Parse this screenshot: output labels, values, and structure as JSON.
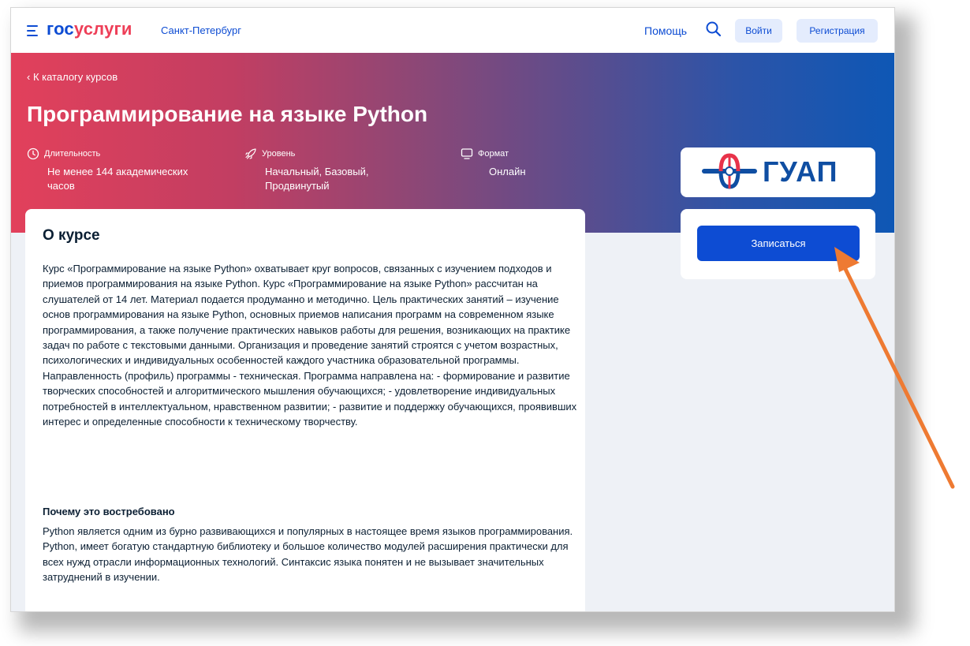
{
  "header": {
    "logo_part1": "гос",
    "logo_part2": "услуги",
    "city": "Санкт-Петербург",
    "help": "Помощь",
    "login": "Войти",
    "register": "Регистрация"
  },
  "hero": {
    "back_link": "‹ К каталогу курсов",
    "title": "Программирование на языке Python",
    "meta": [
      {
        "label": "Длительность",
        "value": "Не менее 144 академических часов"
      },
      {
        "label": "Уровень",
        "value": "Начальный, Базовый, Продвинутый"
      },
      {
        "label": "Формат",
        "value": "Онлайн"
      }
    ]
  },
  "provider": {
    "logo_text": "ГУАП"
  },
  "actions": {
    "enroll": "Записаться"
  },
  "about": {
    "heading": "О курсе",
    "text": "Курс «Программирование на языке Python» охватывает круг вопросов, связанных с изучением подходов и приемов программирования на языке Python. Курс «Программирование на языке Python» рассчитан на слушателей от 14 лет. Материал подается продуманно и методично. Цель практических занятий – изучение основ программирования на языке Python, основных приемов написания программ на современном языке программирования, а также получение практических навыков работы для решения, возникающих на практике задач по работе с текстовыми данными. Организация и проведение занятий строятся с учетом возрастных, психологических и индивидуальных особенностей каждого участника образовательной программы. Направленность (профиль) программы - техническая. Программа направлена на: - формирование и развитие творческих способностей и алгоритмического мышления обучающихся; - удовлетворение индивидуальных потребностей в интеллектуальном, нравственном развитии; - развитие и поддержку обучающихся, проявивших интерес и определенные способности к техническому творчеству.",
    "why_heading": "Почему это востребовано",
    "why_text": "Python является одним из бурно развивающихся и популярных в настоящее время языков программирования. Python, имеет богатую стандартную библиотеку и большое количество модулей расширения практически для всех нужд отрасли информационных технологий. Синтаксис языка понятен и не вызывает значительных затруднений в изучении."
  },
  "colors": {
    "brand_blue": "#0d4cd3",
    "brand_red": "#ee3f58",
    "annotation_arrow": "#ee7a32"
  }
}
